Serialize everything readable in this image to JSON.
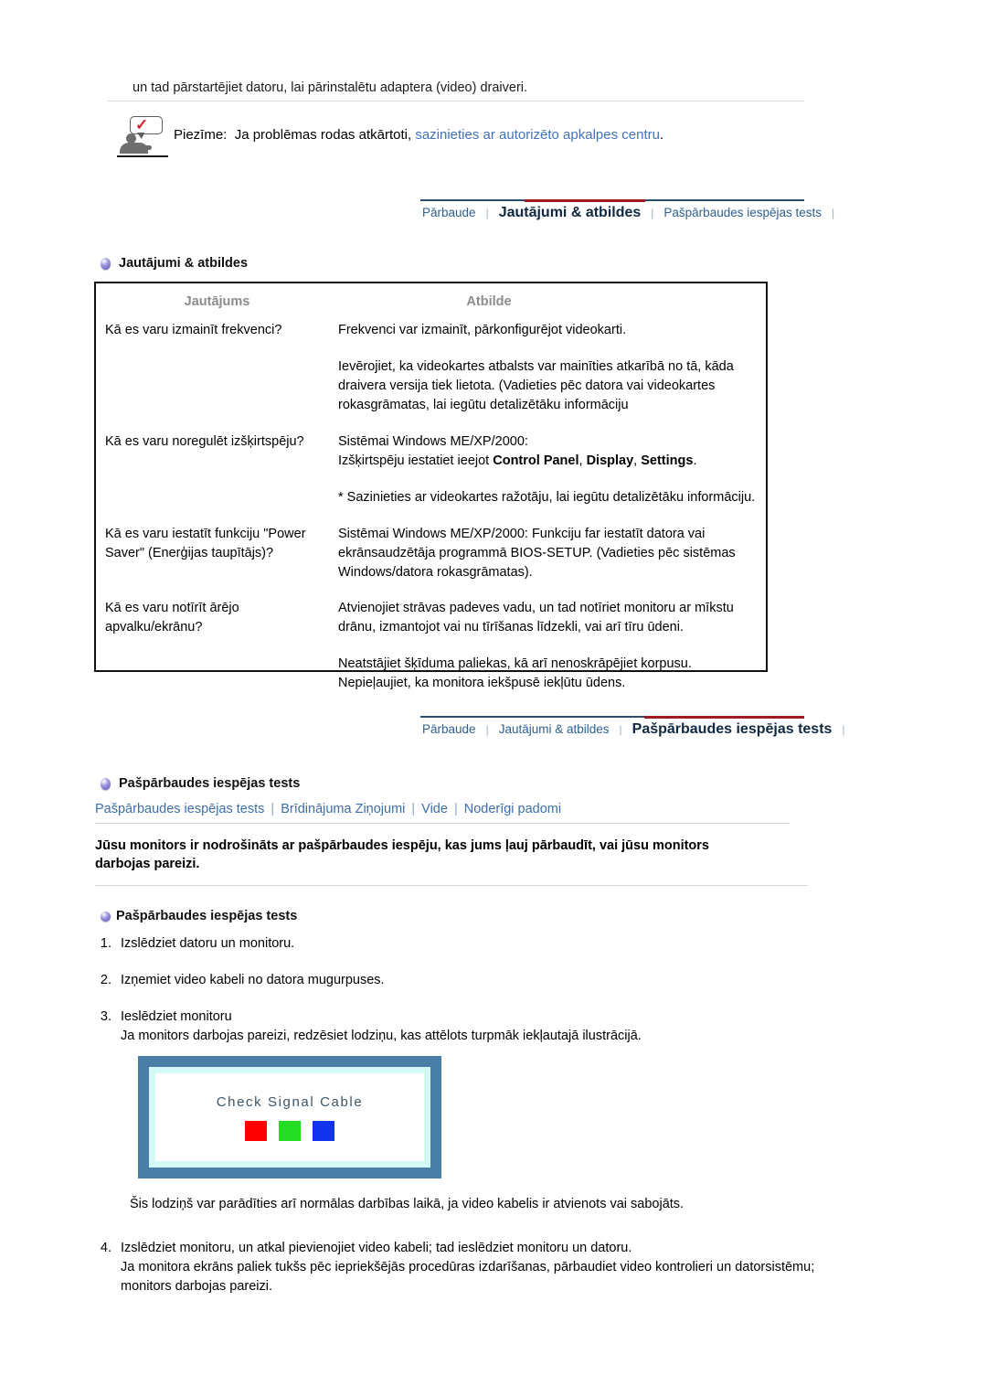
{
  "intro": {
    "line": "un tad pārstartējiet datoru, lai pārinstalētu adaptera (video) draiveri."
  },
  "note": {
    "icon": "note-person-icon",
    "label": "Piezīme:",
    "text": "Ja problēmas rodas atkārtoti,",
    "link": "sazinieties ar autorizēto apkalpes centru",
    "period": "."
  },
  "tabbar_top": {
    "tabs": [
      {
        "label": "Pārbaude",
        "active": false
      },
      {
        "label": "Jautājumi & atbildes",
        "active": true
      },
      {
        "label": "Pašpārbaudes iespējas tests",
        "active": false
      }
    ],
    "separator": "|",
    "rail_color": "#2b4d74",
    "active_color": "#9e1b1f"
  },
  "faq_section": {
    "heading": "Jautājumi & atbildes",
    "columns": {
      "question": "Jautājums",
      "answer": "Atbilde"
    },
    "rows": [
      {
        "question": "Kā es varu izmainīt frekvenci?",
        "answer_lines": [
          "Frekvenci var izmainīt, pārkonfigurējot videokarti.",
          "Ievērojiet, ka videokartes atbalsts var mainīties atkarībā no tā, kāda draivera versija tiek lietota. (Vadieties pēc datora vai videokartes rokasgrāmatas, lai iegūtu detalizētāku informāciju"
        ]
      },
      {
        "question": "Kā es varu noregulēt izšķirtspēju?",
        "answer_line_1": "Sistēmai Windows ME/XP/2000:",
        "answer_line_2_pre": "Izšķirtspēju iestatiet ieejot ",
        "answer_bold_1": "Control Panel",
        "answer_sep_1": ", ",
        "answer_bold_2": "Display",
        "answer_sep_2": ", ",
        "answer_bold_3": "Settings",
        "answer_line_2_post": ".",
        "answer_line_3": "* Sazinieties ar videokartes ražotāju, lai iegūtu detalizētāku informāciju."
      },
      {
        "question": "Kā es varu iestatīt funkciju \"Power Saver\" (Enerģijas taupītājs)?",
        "answer_lines": [
          "Sistēmai Windows ME/XP/2000: Funkciju far iestatīt datora vai ekrānsaudzētāja programmā BIOS-SETUP. (Vadieties pēc sistēmas Windows/datora rokasgrāmatas)."
        ]
      },
      {
        "question": "Kā es varu notīrīt ārējo apvalku/ekrānu?",
        "answer_lines": [
          "Atvienojiet strāvas padeves vadu, un tad notīriet monitoru ar mīkstu drānu, izmantojot vai nu tīrīšanas līdzekli, vai arī tīru ūdeni.",
          "Neatstājiet šķīduma paliekas, kā arī nenoskrāpējiet korpusu. Nepieļaujiet, ka monitora iekšpusē iekļūtu ūdens."
        ]
      }
    ]
  },
  "tabbar_bottom": {
    "tabs": [
      {
        "label": "Pārbaude",
        "active": false
      },
      {
        "label": "Jautājumi & atbildes",
        "active": false
      },
      {
        "label": "Pašpārbaudes iespējas tests",
        "active": true
      }
    ],
    "separator": "|"
  },
  "selftest_section": {
    "heading": "Pašpārbaudes iespējas tests",
    "subnav": [
      "Pašpārbaudes iespējas tests",
      "Brīdinājuma Ziņojumi",
      "Vide",
      "Noderīgi padomi"
    ],
    "subnav_separator": "|",
    "lead_paragraph": "Jūsu monitors ir nodrošināts ar pašpārbaudes iespēju, kas jums ļauj pārbaudīt, vai jūsu monitors darbojas pareizi.",
    "list_heading": "Pašpārbaudes iespējas tests",
    "steps": [
      {
        "num": "1.",
        "lines": [
          "Izslēdziet datoru un monitoru."
        ]
      },
      {
        "num": "2.",
        "lines": [
          "Izņemiet video kabeli no datora mugurpuses."
        ]
      },
      {
        "num": "3.",
        "lines": [
          "Ieslēdziet monitoru",
          "Ja monitors darbojas pareizi, redzēsiet lodziņu, kas attēlots turpmāk iekļautajā ilustrācijā."
        ]
      }
    ],
    "illustration": {
      "message": "Check Signal Cable",
      "swatches": [
        "#ff0000",
        "#22dd22",
        "#1133ee"
      ],
      "frame_color": "#4a7ea6",
      "bezel_color": "#d3f9f9"
    },
    "note_after_illustration": "Šis lodziņš var parādīties arī normālas darbības laikā, ja video kabelis ir atvienots vai sabojāts.",
    "steps2": [
      {
        "num": "4.",
        "lines": [
          "Izslēdziet monitoru, un atkal pievienojiet video kabeli; tad ieslēdziet monitoru un datoru.",
          "Ja monitora ekrāns paliek tukšs pēc iepriekšējās procedūras izdarīšanas, pārbaudiet video kontrolieri un datorsistēmu; monitors darbojas pareizi."
        ]
      }
    ]
  }
}
